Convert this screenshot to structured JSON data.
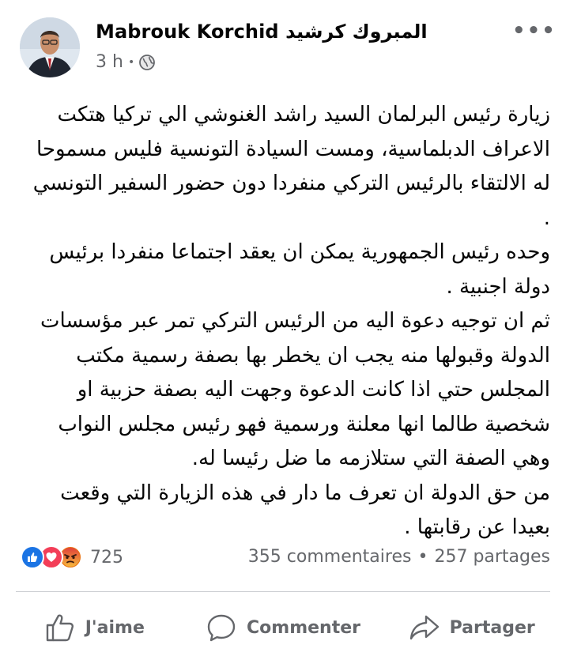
{
  "post": {
    "author": "Mabrouk Korchid المبروك كرشيد",
    "time": "3 h",
    "separator": "•",
    "audience_icon": "globe-icon",
    "more_icon": "more-options-icon",
    "more_label": "•••",
    "text_paragraphs": [
      "زيارة رئيس البرلمان السيد راشد الغنوشي الي تركيا  هتكت الاعراف الدبلماسية، ومست السيادة التونسية فليس مسموحا له  الالتقاء بالرئيس التركي منفردا دون حضور السفير التونسي .",
      "وحده رئيس الجمهورية يمكن ان يعقد اجتماعا منفردا برئيس دولة اجنبية .",
      "ثم ان توجيه دعوة اليه من الرئيس التركي تمر عبر مؤسسات الدولة وقبولها منه يجب ان يخطر بها بصفة رسمية مكتب المجلس  حتي اذا كانت الدعوة وجهت اليه بصفة حزبية او شخصية طالما انها معلنة ورسمية   فهو رئيس مجلس النواب وهي الصفة التي ستلازمه ما ضل رئيسا له.",
      "من حق الدولة   ان  تعرف ما دار في هذه الزيارة التي وقعت بعيدا عن رقابتها ."
    ]
  },
  "stats": {
    "reaction_icons": [
      "like-reaction-icon",
      "love-reaction-icon",
      "angry-reaction-icon"
    ],
    "reaction_count": "725",
    "comments": "355 commentaires",
    "dot": "•",
    "shares": "257 partages"
  },
  "actions": {
    "like_label": "J'aime",
    "comment_label": "Commenter",
    "share_label": "Partager"
  },
  "colors": {
    "like_blue": "#1b74e4",
    "love_red": "#f33e58",
    "angry_orange": "#e9710f",
    "secondary_text": "#65676b"
  }
}
